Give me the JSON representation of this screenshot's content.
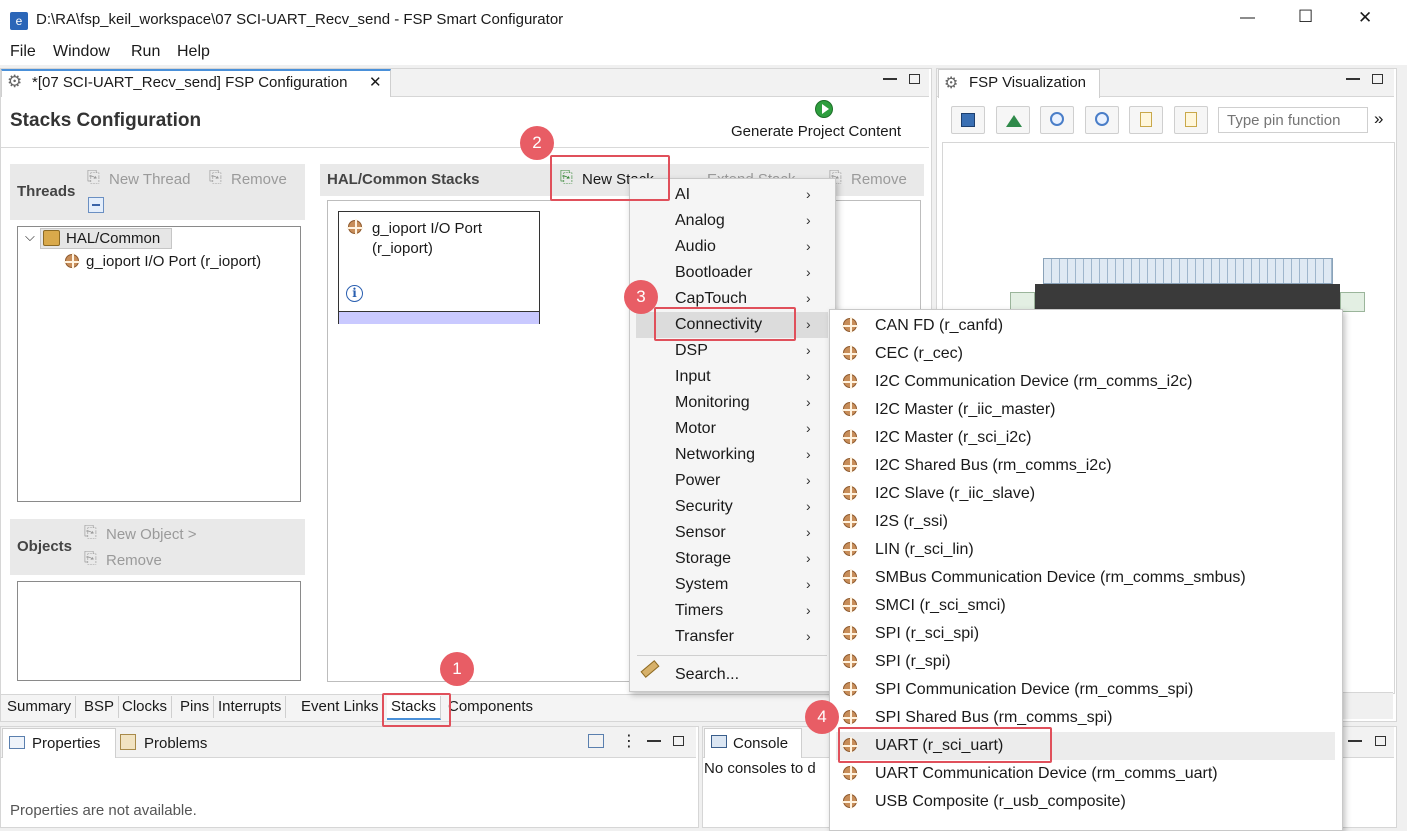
{
  "window": {
    "title": "D:\\RA\\fsp_keil_workspace\\07 SCI-UART_Recv_send - FSP Smart Configurator",
    "controls": {
      "minimize": "—",
      "maximize": "☐",
      "close": "✕"
    }
  },
  "menu": [
    "File",
    "Window",
    "Run",
    "Help"
  ],
  "editor": {
    "tab_title": "*[07 SCI-UART_Recv_send] FSP Configuration",
    "heading": "Stacks Configuration",
    "generate_label": "Generate Project Content"
  },
  "threads": {
    "label": "Threads",
    "new_thread": "New Thread",
    "remove": "Remove",
    "tree_root": "HAL/Common",
    "tree_child": "g_ioport I/O Port (r_ioport)"
  },
  "objects": {
    "label": "Objects",
    "new_object": "New Object >",
    "remove": "Remove"
  },
  "hal": {
    "label": "HAL/Common Stacks",
    "new_stack": "New Stack",
    "extend_stack": "Extend Stack",
    "remove": "Remove",
    "module_line1": "g_ioport I/O Port",
    "module_line2": "(r_ioport)"
  },
  "visualization": {
    "title": "FSP Visualization",
    "pin_placeholder": "Type pin function"
  },
  "bottom_tabs": [
    "Summary",
    "BSP",
    "Clocks",
    "Pins",
    "Interrupts",
    "Event Links",
    "Stacks",
    "Components"
  ],
  "properties": {
    "tab": "Properties",
    "problems_tab": "Problems",
    "message": "Properties are not available."
  },
  "console": {
    "tab": "Console",
    "message": "No consoles to d"
  },
  "context_menu": [
    "AI",
    "Analog",
    "Audio",
    "Bootloader",
    "CapTouch",
    "Connectivity",
    "DSP",
    "Input",
    "Monitoring",
    "Motor",
    "Networking",
    "Power",
    "Security",
    "Sensor",
    "Storage",
    "System",
    "Timers",
    "Transfer"
  ],
  "context_search": "Search...",
  "submenu": [
    "CAN FD (r_canfd)",
    "CEC (r_cec)",
    "I2C Communication Device (rm_comms_i2c)",
    "I2C Master (r_iic_master)",
    "I2C Master (r_sci_i2c)",
    "I2C Shared Bus (rm_comms_i2c)",
    "I2C Slave (r_iic_slave)",
    "I2S (r_ssi)",
    "LIN (r_sci_lin)",
    "SMBus Communication Device (rm_comms_smbus)",
    "SMCI (r_sci_smci)",
    "SPI (r_sci_spi)",
    "SPI (r_spi)",
    "SPI Communication Device (rm_comms_spi)",
    "SPI Shared Bus (rm_comms_spi)",
    "UART (r_sci_uart)",
    "UART Communication Device (rm_comms_uart)",
    "USB Composite (r_usb_composite)"
  ],
  "badges": [
    "1",
    "2",
    "3",
    "4"
  ],
  "colors": {
    "accent_red": "#e0505b",
    "badge": "#e85d65",
    "selection": "#c9c9ff"
  }
}
